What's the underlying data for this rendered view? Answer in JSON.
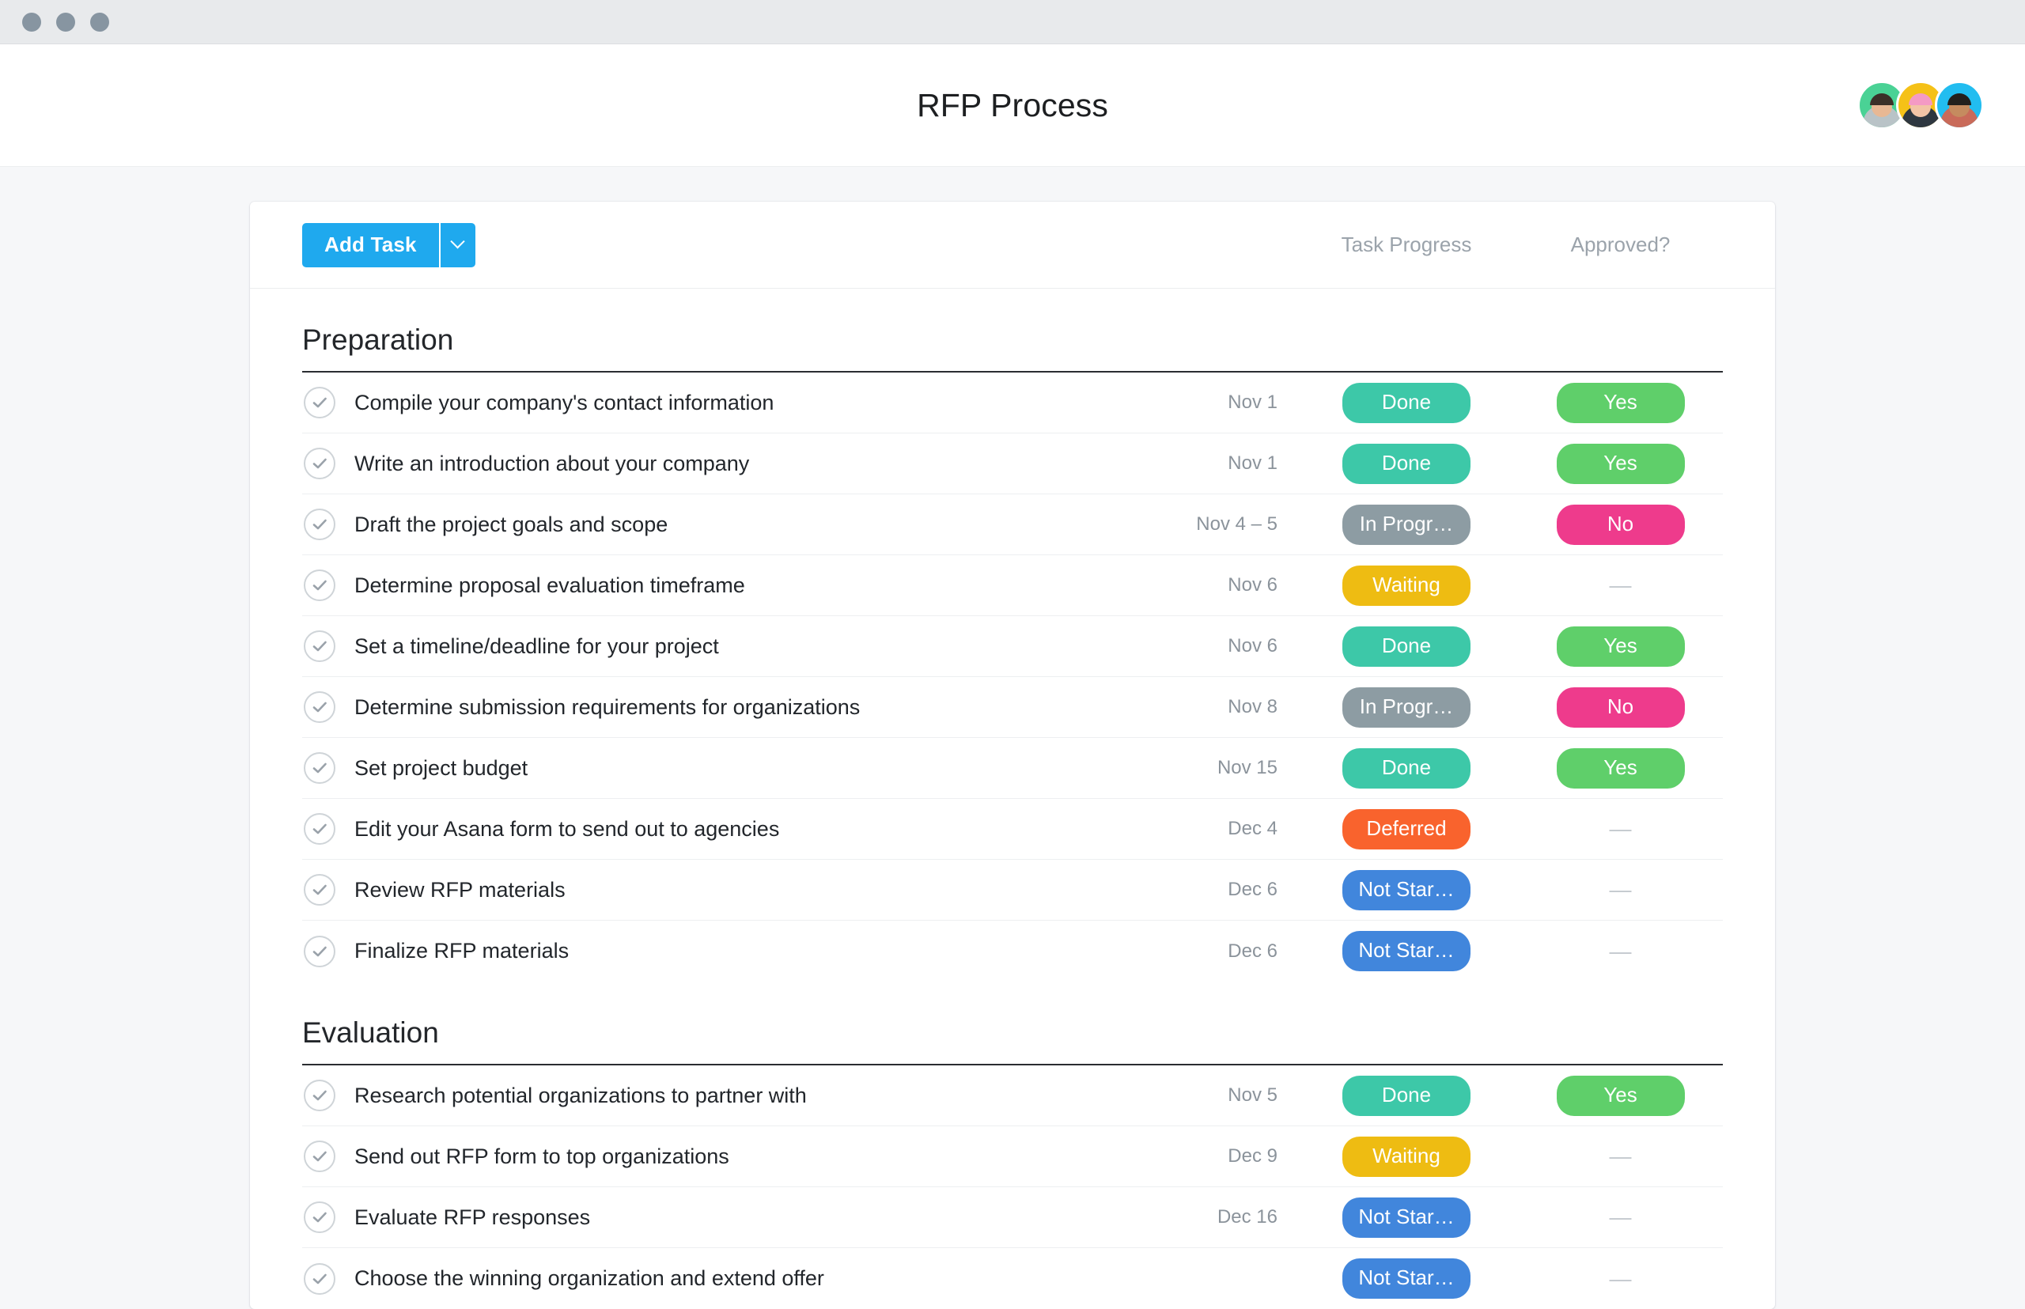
{
  "window": {
    "controls": [
      "close-dot",
      "minimize-dot",
      "maximize-dot"
    ]
  },
  "header": {
    "title": "RFP Process",
    "avatars": [
      {
        "name": "avatar-1",
        "bg": "#4ad295",
        "skin": "#e8b894",
        "hair": "#3b3028",
        "shirt": "#b9c3c7"
      },
      {
        "name": "avatar-2",
        "bg": "#f5c117",
        "skin": "#f2c4a6",
        "hair": "#f49ac4",
        "shirt": "#2e3740"
      },
      {
        "name": "avatar-3",
        "bg": "#22bdf0",
        "skin": "#c58b5f",
        "hair": "#23201d",
        "shirt": "#c96a59"
      }
    ]
  },
  "toolbar": {
    "add_task_label": "Add Task",
    "caret_icon": "chevron-down-icon",
    "columns": {
      "progress": "Task Progress",
      "approved": "Approved?"
    }
  },
  "colors": {
    "accent": "#1fa9ee",
    "done": "#3dc8a8",
    "yes": "#5fcf6a",
    "in_progress": "#8d9ca3",
    "no": "#ee3b8c",
    "waiting": "#eebc12",
    "deferred": "#f9632d",
    "not_started": "#4186dc",
    "empty": "—"
  },
  "sections": [
    {
      "title": "Preparation",
      "tasks": [
        {
          "name": "Compile your company's contact information",
          "due": "Nov 1",
          "progress": "Done",
          "progress_color": "#3dc8a8",
          "approved": "Yes",
          "approved_color": "#5fcf6a"
        },
        {
          "name": "Write an introduction about your company",
          "due": "Nov 1",
          "progress": "Done",
          "progress_color": "#3dc8a8",
          "approved": "Yes",
          "approved_color": "#5fcf6a"
        },
        {
          "name": "Draft the project goals and scope",
          "due": "Nov 4 – 5",
          "progress": "In Progr…",
          "progress_color": "#8d9ca3",
          "approved": "No",
          "approved_color": "#ee3b8c"
        },
        {
          "name": "Determine proposal evaluation timeframe",
          "due": "Nov 6",
          "progress": "Waiting",
          "progress_color": "#eebc12",
          "approved": "—",
          "approved_color": ""
        },
        {
          "name": "Set a timeline/deadline for your project",
          "due": "Nov 6",
          "progress": "Done",
          "progress_color": "#3dc8a8",
          "approved": "Yes",
          "approved_color": "#5fcf6a"
        },
        {
          "name": "Determine submission requirements for organizations",
          "due": "Nov 8",
          "progress": "In Progr…",
          "progress_color": "#8d9ca3",
          "approved": "No",
          "approved_color": "#ee3b8c"
        },
        {
          "name": "Set project budget",
          "due": "Nov 15",
          "progress": "Done",
          "progress_color": "#3dc8a8",
          "approved": "Yes",
          "approved_color": "#5fcf6a"
        },
        {
          "name": "Edit your Asana form to send out to agencies",
          "due": "Dec 4",
          "progress": "Deferred",
          "progress_color": "#f9632d",
          "approved": "—",
          "approved_color": ""
        },
        {
          "name": "Review RFP materials",
          "due": "Dec 6",
          "progress": "Not Star…",
          "progress_color": "#4186dc",
          "approved": "—",
          "approved_color": ""
        },
        {
          "name": "Finalize RFP materials",
          "due": "Dec 6",
          "progress": "Not Star…",
          "progress_color": "#4186dc",
          "approved": "—",
          "approved_color": ""
        }
      ]
    },
    {
      "title": "Evaluation",
      "tasks": [
        {
          "name": "Research potential organizations to partner with",
          "due": "Nov 5",
          "progress": "Done",
          "progress_color": "#3dc8a8",
          "approved": "Yes",
          "approved_color": "#5fcf6a"
        },
        {
          "name": "Send out RFP form to top organizations",
          "due": "Dec 9",
          "progress": "Waiting",
          "progress_color": "#eebc12",
          "approved": "—",
          "approved_color": ""
        },
        {
          "name": "Evaluate RFP responses",
          "due": "Dec 16",
          "progress": "Not Star…",
          "progress_color": "#4186dc",
          "approved": "—",
          "approved_color": ""
        },
        {
          "name": "Choose the winning organization and extend offer",
          "due": "",
          "progress": "Not Star…",
          "progress_color": "#4186dc",
          "approved": "—",
          "approved_color": ""
        }
      ]
    }
  ]
}
